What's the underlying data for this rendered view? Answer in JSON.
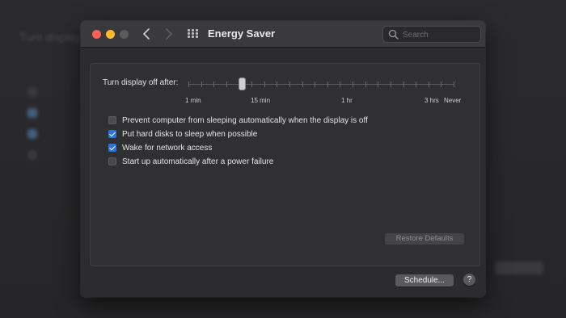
{
  "window": {
    "title": "Energy Saver",
    "search": {
      "placeholder": "Search",
      "value": ""
    }
  },
  "slider": {
    "label": "Turn display off after:",
    "tick_labels": [
      "1 min",
      "15 min",
      "1 hr",
      "3 hrs",
      "Never"
    ],
    "value_label": "15 min"
  },
  "options": [
    {
      "label": "Prevent computer from sleeping automatically when the display is off",
      "checked": false
    },
    {
      "label": "Put hard disks to sleep when possible",
      "checked": true
    },
    {
      "label": "Wake for network access",
      "checked": true
    },
    {
      "label": "Start up automatically after a power failure",
      "checked": false
    }
  ],
  "buttons": {
    "restore_defaults": "Restore Defaults",
    "schedule": "Schedule...",
    "help": "?"
  },
  "colors": {
    "accent": "#2a74e0",
    "close": "#ff5f57",
    "minimize": "#febc2e"
  },
  "icons": [
    "back-arrow-icon",
    "forward-arrow-icon",
    "grid-icon",
    "search-icon",
    "help-icon"
  ]
}
